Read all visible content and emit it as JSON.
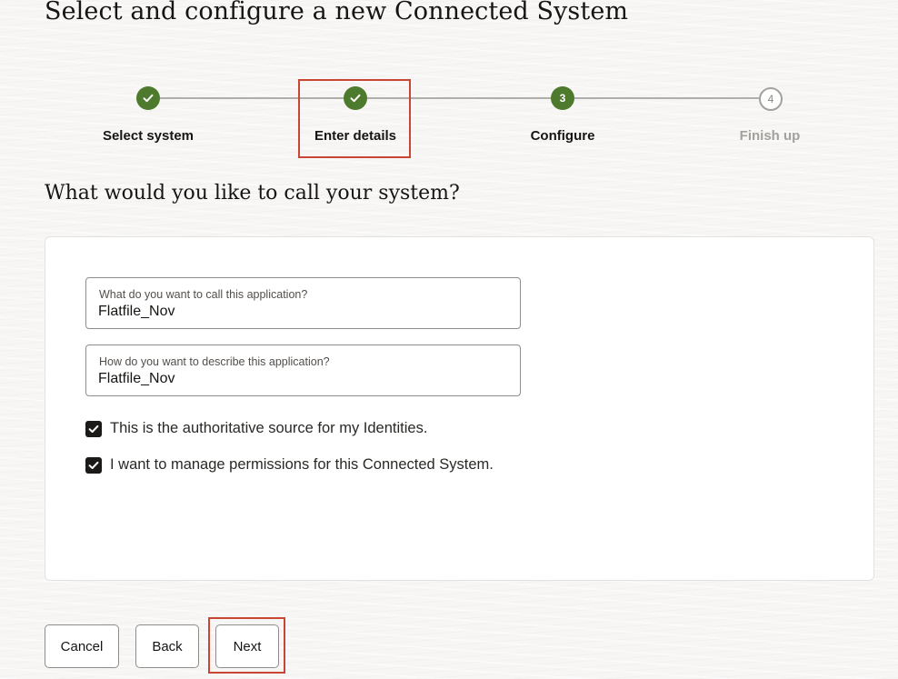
{
  "page": {
    "title": "Select and configure a new Connected System",
    "subtitle": "What would you like to call your system?"
  },
  "stepper": {
    "steps": [
      {
        "label": "Select system",
        "status": "complete",
        "icon": "check-icon"
      },
      {
        "label": "Enter details",
        "status": "complete",
        "icon": "check-icon"
      },
      {
        "label": "Configure",
        "status": "current",
        "number": "3"
      },
      {
        "label": "Finish up",
        "status": "upcoming",
        "number": "4"
      }
    ],
    "complete_color": "#4d7a2c",
    "upcoming_color": "#a3a19e"
  },
  "form": {
    "name_field": {
      "label": "What do you want to call this application?",
      "value": "Flatfile_Nov"
    },
    "description_field": {
      "label": "How do you want to describe this application?",
      "value": "Flatfile_Nov"
    },
    "checkboxes": [
      {
        "label": "This is the authoritative source for my Identities.",
        "checked": true
      },
      {
        "label": "I want to manage permissions for this Connected System.",
        "checked": true
      }
    ]
  },
  "buttons": {
    "cancel": "Cancel",
    "back": "Back",
    "next": "Next"
  },
  "annotation_color": "#c74634"
}
